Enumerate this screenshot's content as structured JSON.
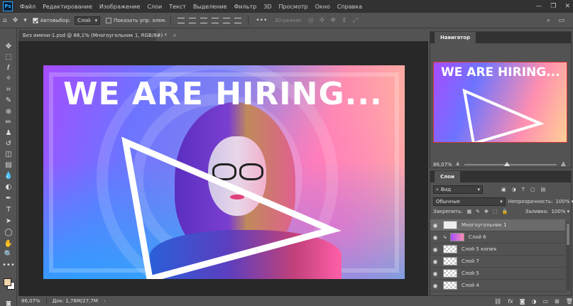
{
  "app": {
    "logo": "Ps"
  },
  "menu": [
    "Файл",
    "Редактирование",
    "Изображение",
    "Слои",
    "Текст",
    "Выделение",
    "Фильтр",
    "3D",
    "Просмотр",
    "Окно",
    "Справка"
  ],
  "window_controls": {
    "minimize": "—",
    "restore": "❐",
    "close": "✕"
  },
  "options_bar": {
    "auto_select_label": "Автовыбор:",
    "auto_select_value": "Слой",
    "show_transform_label": "Показать упр. элем.",
    "mode_3d_label": "3D-режим:"
  },
  "document": {
    "tab_title": "Без имени-1.psd @ 86,1% (Многоугольник 1, RGB/8#) *",
    "close": "×",
    "headline": "WE ARE HIRING..."
  },
  "navigator": {
    "tab": "Навигатор",
    "zoom": "86,07%",
    "headline": "WE ARE HIRING..."
  },
  "layers_panel": {
    "tab": "Слои",
    "filter_kind": "Вид",
    "blend_mode": "Обычные",
    "opacity_label": "Непрозрачность:",
    "opacity_value": "100%",
    "lock_label": "Закрепить:",
    "fill_label": "Заливка:",
    "fill_value": "100%",
    "layers": [
      {
        "name": "Многоугольник 1",
        "selected": true
      },
      {
        "name": "Слой 6",
        "selected": false
      },
      {
        "name": "Слой 5 копия",
        "selected": false
      },
      {
        "name": "Слой 7",
        "selected": false
      },
      {
        "name": "Слой 5",
        "selected": false
      },
      {
        "name": "Слой 4",
        "selected": false
      }
    ],
    "footer_icons": [
      "link-icon",
      "fx-icon",
      "mask-icon",
      "adjustment-icon",
      "group-icon",
      "new-layer-icon",
      "trash-icon"
    ]
  },
  "status_bar": {
    "zoom": "86,07%",
    "doc_size": "Док: 1,78М/27,7М"
  },
  "colors": {
    "foreground": "#f0d5aa",
    "background": "#ffffff",
    "panel": "#535353",
    "menubar": "#323232"
  }
}
